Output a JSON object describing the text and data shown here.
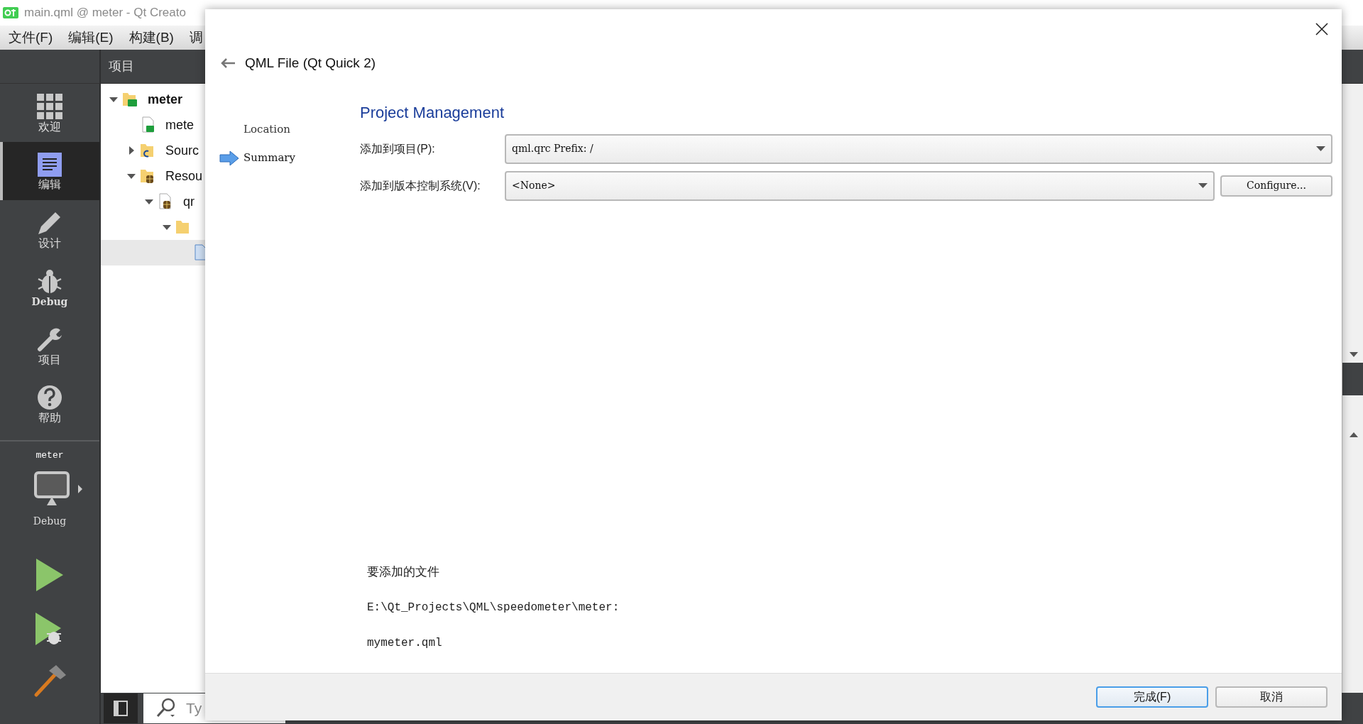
{
  "app": {
    "title": "main.qml @ meter - Qt Creato",
    "menu": [
      "文件(F)",
      "编辑(E)",
      "构建(B)",
      "调"
    ]
  },
  "sidebar": {
    "modes": [
      {
        "label": "欢迎",
        "kind": "welcome",
        "selected": false
      },
      {
        "label": "编辑",
        "kind": "edit",
        "selected": true
      },
      {
        "label": "设计",
        "kind": "design",
        "selected": false
      },
      {
        "label": "Debug",
        "kind": "debug",
        "selected": false
      },
      {
        "label": "项目",
        "kind": "projects",
        "selected": false
      },
      {
        "label": "帮助",
        "kind": "help",
        "selected": false
      }
    ],
    "target": {
      "project": "meter",
      "config": "Debug"
    }
  },
  "project_panel": {
    "title": "项目",
    "tree": [
      {
        "label": "meter",
        "kind": "project",
        "expanded": true,
        "selected": false,
        "children": [
          {
            "label": "mete",
            "kind": "file",
            "selected": false
          },
          {
            "label": "Sourc",
            "kind": "sources",
            "expanded": false,
            "selected": false
          },
          {
            "label": "Resou",
            "kind": "resources",
            "expanded": true,
            "selected": false,
            "children": [
              {
                "label": "qr",
                "kind": "qrc",
                "expanded": true,
                "selected": false,
                "children": [
                  {
                    "kind": "folder",
                    "expanded": true,
                    "selected": false,
                    "children": [
                      {
                        "kind": "qml",
                        "selected": true
                      }
                    ]
                  }
                ]
              }
            ]
          }
        ]
      }
    ]
  },
  "locator": {
    "placeholder": "Ty"
  },
  "dialog": {
    "title": "QML File (Qt Quick 2)",
    "steps": [
      {
        "label": "Location",
        "selected": false
      },
      {
        "label": "Summary",
        "selected": true
      }
    ],
    "heading": "Project Management",
    "fields": [
      {
        "label": "添加到项目(P):",
        "value": "qml.qrc Prefix: /"
      },
      {
        "label": "添加到版本控制系统(V):",
        "value": "<None>",
        "button": "Configure..."
      }
    ],
    "files_heading": "要添加的文件",
    "files_path": "E:\\Qt_Projects\\QML\\speedometer\\meter:",
    "files": [
      "mymeter.qml"
    ],
    "buttons": [
      {
        "label": "完成(F)",
        "default": true
      },
      {
        "label": "取消",
        "default": false
      }
    ]
  }
}
